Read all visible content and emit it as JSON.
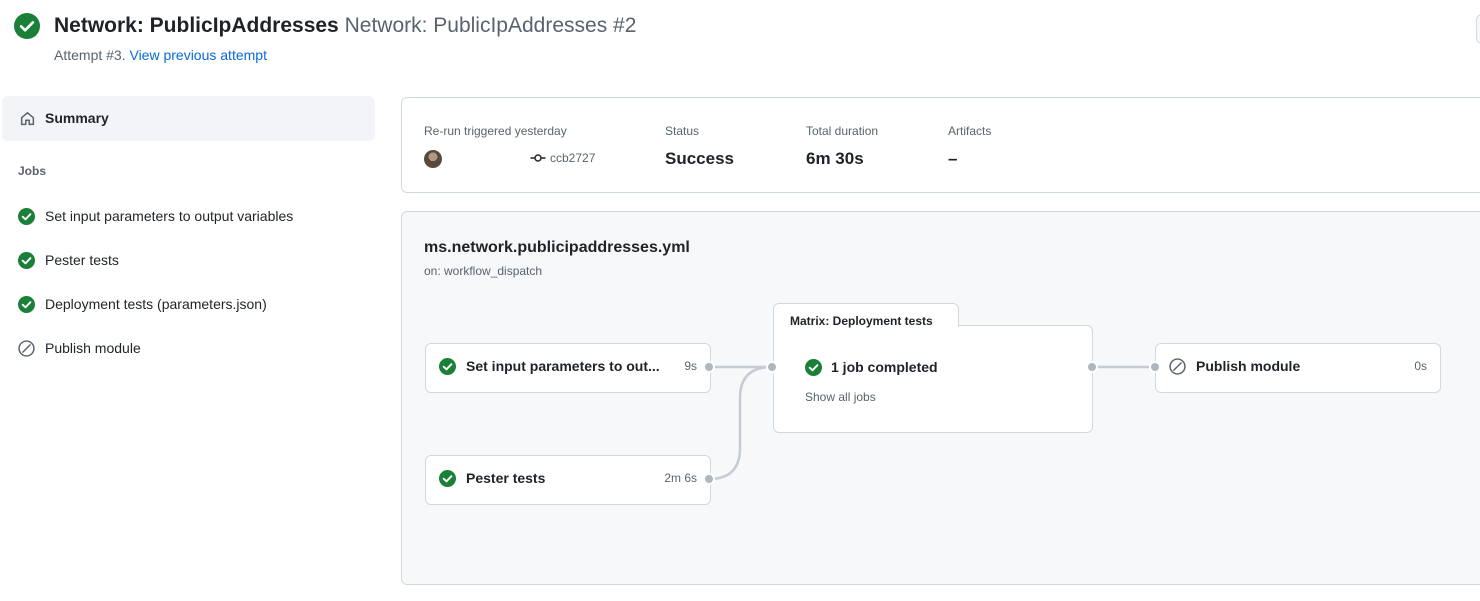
{
  "header": {
    "title": "Network: PublicIpAddresses",
    "subtitle": "Network: PublicIpAddresses #2",
    "attempt_text": "Attempt #3.",
    "view_previous_link": "View previous attempt"
  },
  "sidebar": {
    "summary_label": "Summary",
    "jobs_heading": "Jobs",
    "jobs": [
      {
        "label": "Set input parameters to output variables",
        "status": "success",
        "icon": "check-circle-icon"
      },
      {
        "label": "Pester tests",
        "status": "success",
        "icon": "check-circle-icon"
      },
      {
        "label": "Deployment tests (parameters.json)",
        "status": "success",
        "icon": "check-circle-icon"
      },
      {
        "label": "Publish module",
        "status": "skipped",
        "icon": "skipped-icon"
      }
    ]
  },
  "run_info": {
    "trigger_label": "Re-run triggered yesterday",
    "commit": "ccb2727",
    "status_label": "Status",
    "status_value": "Success",
    "duration_label": "Total duration",
    "duration_value": "6m 30s",
    "artifacts_label": "Artifacts",
    "artifacts_value": "–"
  },
  "workflow": {
    "name": "ms.network.publicipaddresses.yml",
    "trigger": "on: workflow_dispatch",
    "nodes": {
      "set_input": {
        "label": "Set input parameters to out...",
        "duration": "9s",
        "status": "success"
      },
      "pester": {
        "label": "Pester tests",
        "duration": "2m 6s",
        "status": "success"
      },
      "matrix": {
        "tab_label": "Matrix: Deployment tests",
        "status_text": "1 job completed",
        "show_all": "Show all jobs"
      },
      "publish": {
        "label": "Publish module",
        "duration": "0s",
        "status": "skipped"
      }
    }
  },
  "colors": {
    "success": "#1a7f37",
    "link": "#0969da",
    "muted": "#59636e",
    "border": "#d1d9e0",
    "graph_bg": "#f6f8fa"
  }
}
